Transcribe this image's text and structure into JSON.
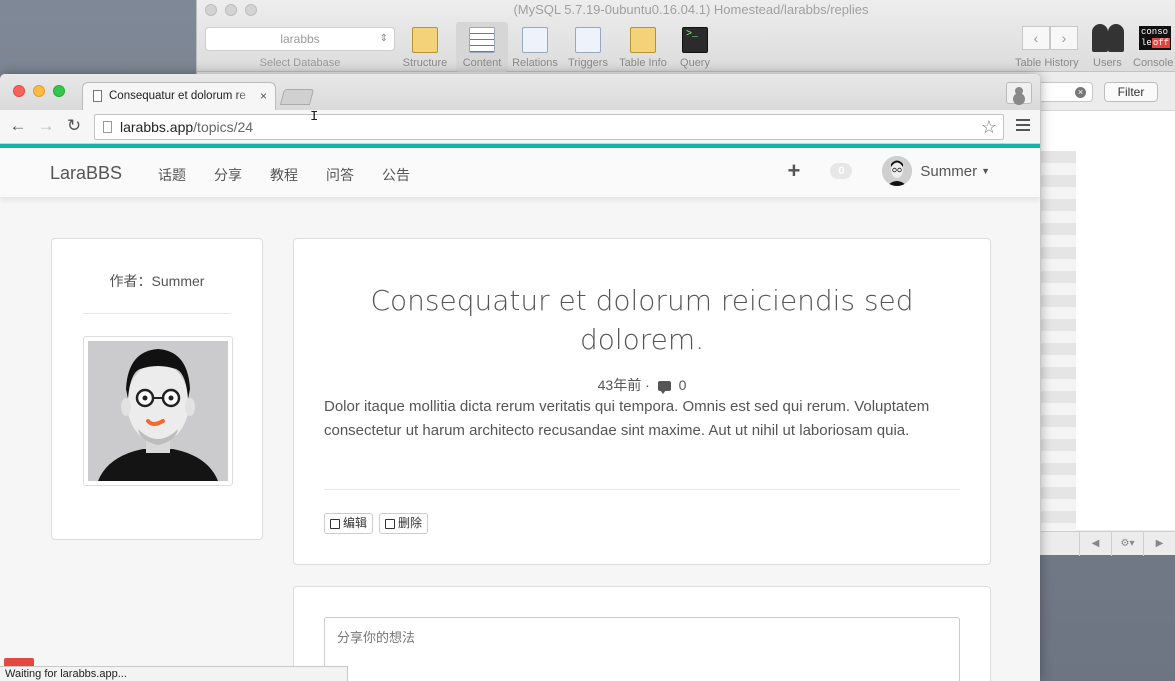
{
  "sequel_pro": {
    "title": "(MySQL 5.7.19-0ubuntu0.16.04.1) Homestead/larabbs/replies",
    "database_value": "larabbs",
    "database_label": "Select Database",
    "tools": [
      "Structure",
      "Content",
      "Relations",
      "Triggers",
      "Table Info",
      "Query"
    ],
    "right_tools": [
      "Table History",
      "Users",
      "Console"
    ],
    "console_icon_text": [
      "conso",
      "le",
      "off"
    ],
    "filter_button": "Filter"
  },
  "browser": {
    "tab_title": "Consequatur et dolorum re",
    "url_host": "larabbs.app",
    "url_path": "/topics/24",
    "status": "Waiting for larabbs.app..."
  },
  "navbar": {
    "brand": "LaraBBS",
    "links": [
      "话题",
      "分享",
      "教程",
      "问答",
      "公告"
    ],
    "notification_count": "0",
    "user_name": "Summer"
  },
  "author": {
    "label": "作者：Summer"
  },
  "topic": {
    "title": "Consequatur et dolorum reiciendis sed dolorem.",
    "time": "43年前",
    "separator": "·",
    "reply_count": "0",
    "body": "Dolor itaque mollitia dicta rerum veritatis qui tempora. Omnis est sed qui rerum. Voluptatem consectetur ut harum architecto recusandae sint maxime. Aut ut nihil ut laboriosam quia.",
    "edit_label": "编辑",
    "delete_label": "删除"
  },
  "reply": {
    "placeholder": "分享你的想法"
  },
  "colors": {
    "accent": "#17b3a9",
    "close_red": "#fc605c",
    "minimize_yellow": "#fdbc40",
    "zoom_green": "#34c84a"
  }
}
